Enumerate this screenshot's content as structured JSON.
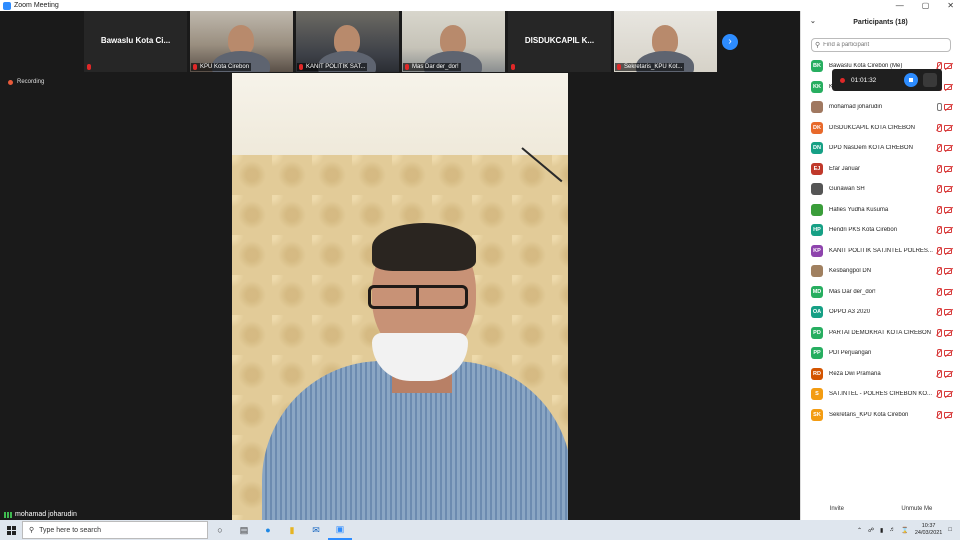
{
  "window": {
    "title": "Zoom Meeting",
    "controls": [
      "—",
      "▢",
      "✕"
    ]
  },
  "recording_label": "Recording",
  "thumbnails": [
    {
      "name": "Bawaslu Kota Ci...",
      "video": false,
      "label": ""
    },
    {
      "name": "",
      "video": true,
      "scene": "office",
      "label": "KPU Kota Cirebon"
    },
    {
      "name": "",
      "video": true,
      "scene": "dark",
      "label": "KANIT POLITIK SAT..."
    },
    {
      "name": "",
      "video": true,
      "scene": "bright",
      "label": "Mas Dar der_dor!"
    },
    {
      "name": "DISDUKCAPIL K...",
      "video": false,
      "label": ""
    },
    {
      "name": "",
      "video": true,
      "scene": "wall",
      "label": "Sekretaris_KPU Kot..."
    }
  ],
  "main_speaker": {
    "name": "mohamad joharudin"
  },
  "recording_overlay": {
    "time": "01:01:32"
  },
  "participants_panel": {
    "title": "Participants (18)",
    "search_placeholder": "Find a participant",
    "participants": [
      {
        "initials": "BK",
        "color": "#27ae60",
        "name": "Bawaslu Kota Cirebon (Me)",
        "mic": "off"
      },
      {
        "initials": "KK",
        "color": "#27ae60",
        "name": "KPU Kota Cirebon",
        "mic": "off"
      },
      {
        "initials": "",
        "color": "#a07860",
        "name": "mohamad joharudin",
        "mic": "on"
      },
      {
        "initials": "DK",
        "color": "#e8692b",
        "name": "DISDUKCAPIL KOTA CIREBON",
        "mic": "off"
      },
      {
        "initials": "DN",
        "color": "#16a085",
        "name": "DPD NasDem KOTA CIREBON",
        "mic": "off"
      },
      {
        "initials": "EJ",
        "color": "#c0392b",
        "name": "Efar Januar",
        "mic": "off"
      },
      {
        "initials": "",
        "color": "#555555",
        "name": "Gunawan SH",
        "mic": "off"
      },
      {
        "initials": "",
        "color": "#3a9d3a",
        "name": "Hafies Yudha Kusuma",
        "mic": "off"
      },
      {
        "initials": "HP",
        "color": "#16a085",
        "name": "Hendri PKS Kota Cirebon",
        "mic": "off"
      },
      {
        "initials": "KP",
        "color": "#8e44ad",
        "name": "KANIT POLITIK SAT.INTEL POLRES...",
        "mic": "off"
      },
      {
        "initials": "",
        "color": "#a08060",
        "name": "Kesbangpol DN",
        "mic": "off"
      },
      {
        "initials": "MD",
        "color": "#27ae60",
        "name": "Mas Dar der_dor!",
        "mic": "off"
      },
      {
        "initials": "OA",
        "color": "#16a085",
        "name": "OPPO A3 2020",
        "mic": "off"
      },
      {
        "initials": "PD",
        "color": "#27ae60",
        "name": "PARTAI DEMOKRAT KOTA CIREBON",
        "mic": "off"
      },
      {
        "initials": "PP",
        "color": "#27ae60",
        "name": "PDI Perjuangan",
        "mic": "off"
      },
      {
        "initials": "RD",
        "color": "#d35400",
        "name": "Reza Dwi Pramana",
        "mic": "off"
      },
      {
        "initials": "S",
        "color": "#f39c12",
        "name": "SAT.INTEL - POLRES CIREBON KO...",
        "mic": "off"
      },
      {
        "initials": "SK",
        "color": "#f39c12",
        "name": "Sekretaris_KPU Kota Cirebon",
        "mic": "off"
      }
    ],
    "footer": {
      "invite": "Invite",
      "unmute": "Unmute Me"
    }
  },
  "taskbar": {
    "search_placeholder": "Type here to search",
    "tray": {
      "time": "10:37",
      "date": "24/03/2021"
    }
  }
}
